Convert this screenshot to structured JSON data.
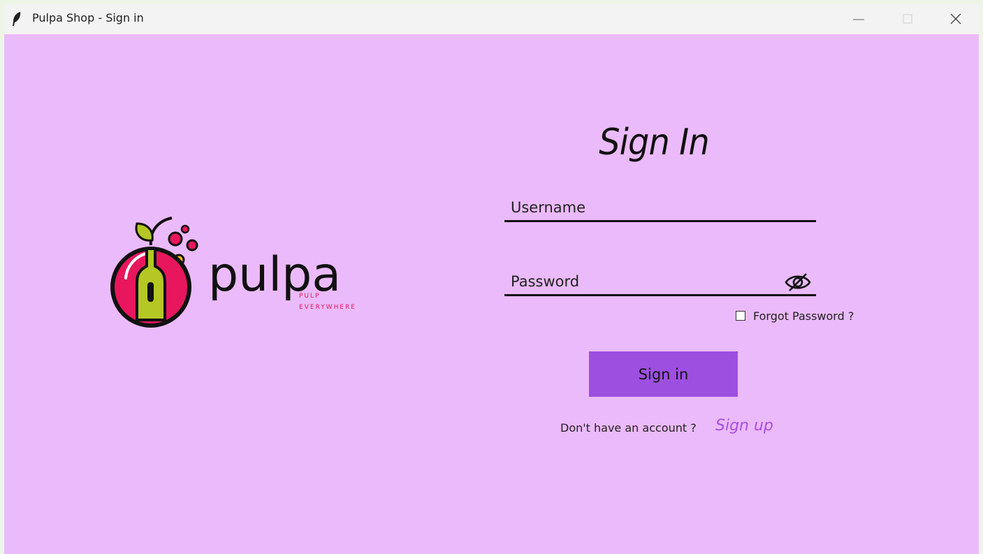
{
  "window": {
    "title": "Pulpa Shop - Sign in",
    "app_icon": "feather-icon",
    "controls": [
      "minimize-icon",
      "maximize-icon",
      "close-icon"
    ]
  },
  "colors": {
    "background": "#ebbafa",
    "titlebar": "#f3f3f3",
    "button": "#9d4fe0",
    "link": "#a74fe3",
    "logo_red": "#e8175d",
    "logo_green": "#b5c724"
  },
  "logo": {
    "wordmark": "pulpa",
    "tagline_1": "PULP",
    "tagline_2": "EVERYWHERE"
  },
  "form": {
    "heading": "Sign In",
    "username_placeholder": "Username",
    "password_placeholder": "Password",
    "password_toggle_icon": "eye-slash-icon",
    "forgot_label": "Forgot Password ?",
    "signin_label": "Sign in",
    "no_account_text": "Don't have an account ?",
    "signup_label": "Sign up"
  }
}
